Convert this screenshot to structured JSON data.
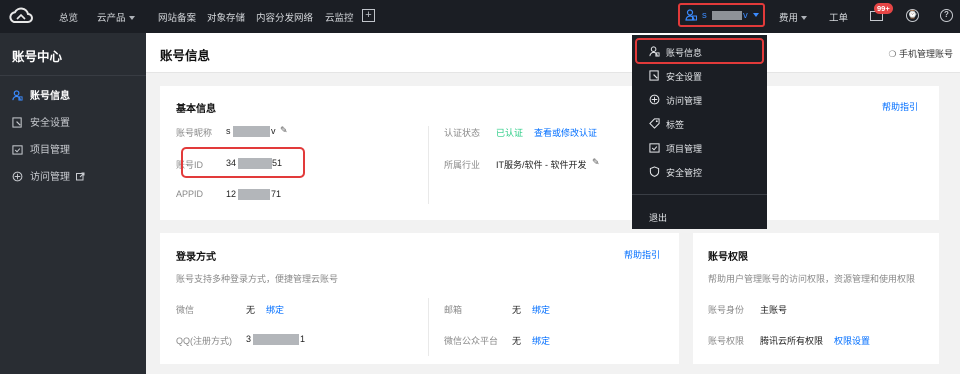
{
  "topbar": {
    "nav": [
      "总览",
      "云产品",
      "网站备案",
      "对象存储",
      "内容分发网络",
      "云监控"
    ],
    "user_initial": "s",
    "user_suffix": "v",
    "right": [
      "费用",
      "工单"
    ],
    "badge": "99+",
    "colors": {
      "bg": "#1b1e24",
      "accent": "#006eff",
      "highlight": "#e23a3a"
    }
  },
  "sidebar": {
    "title": "账号中心",
    "items": [
      {
        "label": "账号信息",
        "icon": "user-icon",
        "active": true
      },
      {
        "label": "安全设置",
        "icon": "shield-edit-icon"
      },
      {
        "label": "项目管理",
        "icon": "folder-icon"
      },
      {
        "label": "访问管理",
        "icon": "access-icon",
        "external": true
      }
    ]
  },
  "page": {
    "title": "账号信息",
    "mobile_manage": "手机管理账号"
  },
  "basic": {
    "title": "基本信息",
    "help": "帮助指引",
    "nickname_label": "账号昵称",
    "nickname_prefix": "s",
    "nickname_suffix": "v",
    "id_label": "账号ID",
    "id_prefix": "34",
    "id_suffix": "51",
    "appid_label": "APPID",
    "appid_prefix": "12",
    "appid_suffix": "71",
    "auth_label": "认证状态",
    "auth_value": "已认证",
    "auth_link": "查看或修改认证",
    "industry_label": "所属行业",
    "industry_value": "IT服务/软件 - 软件开发"
  },
  "login": {
    "title": "登录方式",
    "help": "帮助指引",
    "desc": "账号支持多种登录方式，便捷管理云账号",
    "wechat_label": "微信",
    "wechat_value": "无",
    "wechat_link": "绑定",
    "qq_label": "QQ(注册方式)",
    "qq_prefix": "3",
    "qq_suffix": "1",
    "email_label": "邮箱",
    "email_value": "无",
    "email_link": "绑定",
    "mp_label": "微信公众平台",
    "mp_value": "无",
    "mp_link": "绑定"
  },
  "perm": {
    "title": "账号权限",
    "desc": "帮助用户管理账号的访问权限，资源管理和使用权限",
    "identity_label": "账号身份",
    "identity_value": "主账号",
    "perm_label": "账号权限",
    "perm_value": "腾讯云所有权限",
    "perm_link": "权限设置"
  },
  "dropdown": {
    "items": [
      {
        "label": "账号信息",
        "icon": "user-icon"
      },
      {
        "label": "安全设置",
        "icon": "shield-edit-icon"
      },
      {
        "label": "访问管理",
        "icon": "access-icon"
      },
      {
        "label": "标签",
        "icon": "tag-icon"
      },
      {
        "label": "项目管理",
        "icon": "folder-icon"
      },
      {
        "label": "安全管控",
        "icon": "shield-icon"
      }
    ],
    "logout": "退出"
  }
}
